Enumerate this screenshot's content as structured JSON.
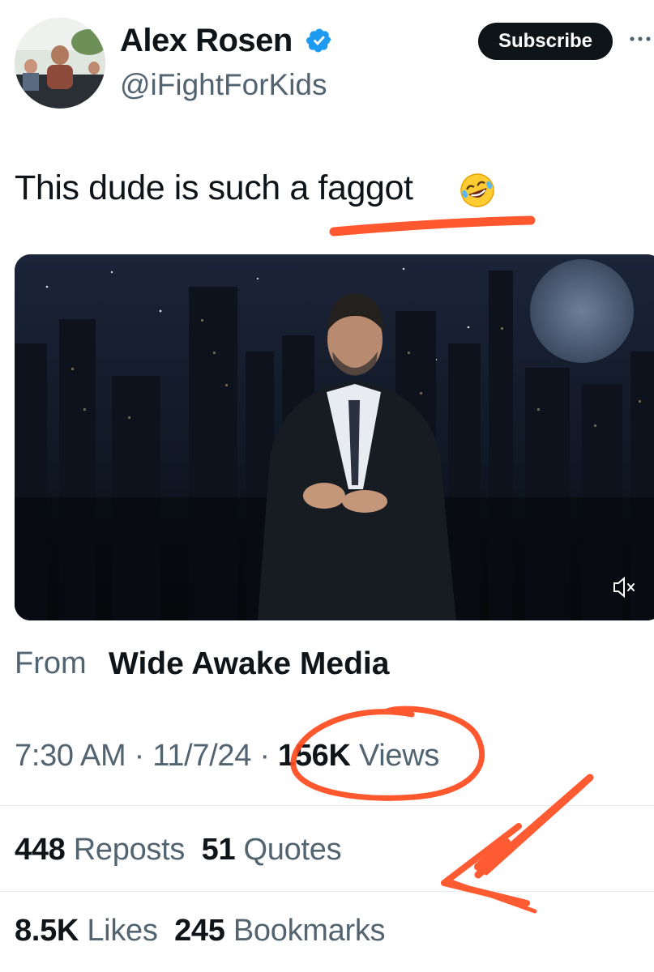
{
  "author": {
    "name": "Alex Rosen",
    "handle": "@iFightForKids",
    "verified": true
  },
  "actions": {
    "subscribe_label": "Subscribe",
    "more_icon": "more-horizontal-icon"
  },
  "tweet": {
    "text": "This dude is such a faggot",
    "emoji": "🤣"
  },
  "media": {
    "type": "video",
    "mute_icon": "speaker-muted-icon"
  },
  "source": {
    "prefix": "From",
    "name": "Wide Awake Media"
  },
  "meta": {
    "time": "7:30 AM",
    "separator": "·",
    "date": "11/7/24",
    "views_count": "156K",
    "views_label": "Views"
  },
  "stats": {
    "reposts_count": "448",
    "reposts_label": "Reposts",
    "quotes_count": "51",
    "quotes_label": "Quotes",
    "likes_count": "8.5K",
    "likes_label": "Likes",
    "bookmarks_count": "245",
    "bookmarks_label": "Bookmarks"
  },
  "colors": {
    "text": "#0f1419",
    "secondary": "#536471",
    "verified_blue": "#1d9bf0",
    "annotation": "#ff4a1c"
  }
}
